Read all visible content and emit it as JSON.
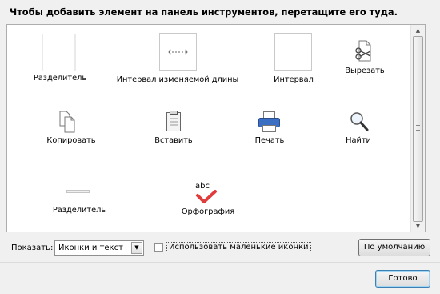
{
  "dialog": {
    "title": "Чтобы добавить элемент на панель инструментов, перетащите его туда."
  },
  "palette": {
    "items": [
      {
        "label": "Разделитель",
        "icon": "separator-icon"
      },
      {
        "label": "Интервал изменяемой длины",
        "icon": "flexible-space-icon"
      },
      {
        "label": "Интервал",
        "icon": "space-icon"
      },
      {
        "label": "Вырезать",
        "icon": "scissors-icon"
      },
      {
        "label": "Копировать",
        "icon": "copy-icon"
      },
      {
        "label": "Вставить",
        "icon": "clipboard-icon"
      },
      {
        "label": "Печать",
        "icon": "printer-icon"
      },
      {
        "label": "Найти",
        "icon": "magnifier-icon"
      },
      {
        "label": "Разделитель",
        "icon": "horizontal-separator-icon"
      },
      {
        "label": "Орфография",
        "icon": "spellcheck-icon",
        "icon_text": "abc"
      }
    ]
  },
  "footer": {
    "show_label": "Показать:",
    "show_value": "Иконки и текст",
    "small_icons_label": "Использовать маленькие иконки",
    "small_icons_checked": false,
    "restore_default_label": "По умолчанию",
    "done_label": "Готово"
  },
  "colors": {
    "spellcheck_red": "#e03c3c",
    "printer_blue": "#3a6fc4"
  }
}
